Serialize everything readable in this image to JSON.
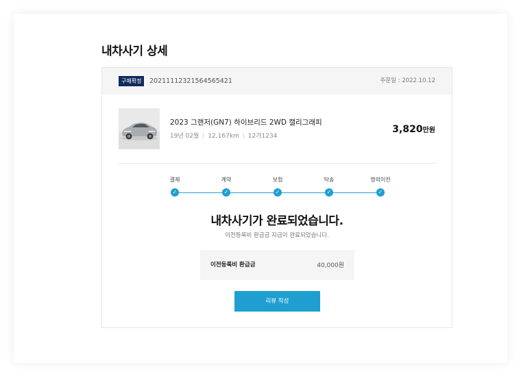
{
  "page": {
    "title": "내차사기 상세"
  },
  "order": {
    "status_badge": "구매확정",
    "number": "20211112321564565421",
    "date": "주문일 : 2022.10.12"
  },
  "car": {
    "name": "2023 그랜저(GN7) 하이브리드 2WD 캘리그래피",
    "year": "19년 02월",
    "mileage": "12,167km",
    "plate": "12가1234",
    "price_value": "3,820",
    "price_unit": "만원"
  },
  "progress": {
    "steps": [
      {
        "label": "결제",
        "done": true
      },
      {
        "label": "계약",
        "done": true
      },
      {
        "label": "보험",
        "done": true
      },
      {
        "label": "탁송",
        "done": true
      },
      {
        "label": "명의이전",
        "done": true
      }
    ],
    "accent_color": "#1f9fd0"
  },
  "completion": {
    "title": "내차사기가 완료되었습니다.",
    "subtitle": "이전등록비 환급금 지급이 완료되었습니다."
  },
  "refund": {
    "label": "이전등록비 환급금",
    "amount": "40,000원"
  },
  "actions": {
    "review_label": "리뷰 작성"
  },
  "colors": {
    "badge": "#102a5c",
    "accent": "#1f9fd0"
  }
}
